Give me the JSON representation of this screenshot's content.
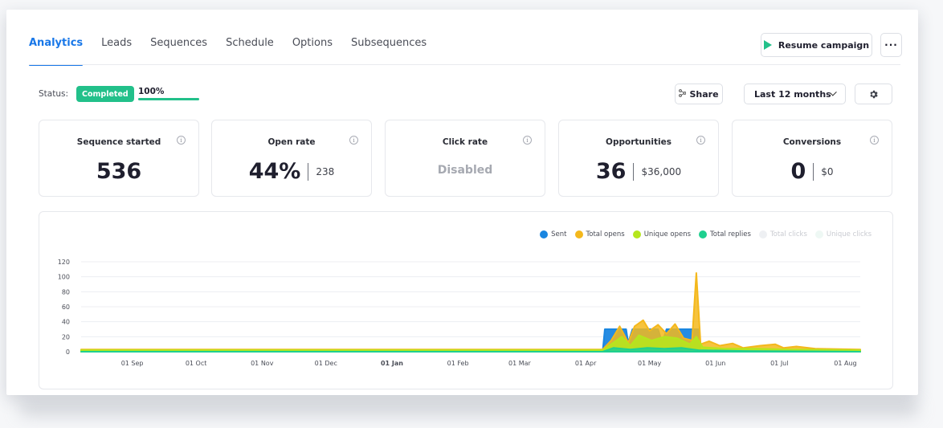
{
  "tabs": [
    {
      "label": "Analytics",
      "active": true
    },
    {
      "label": "Leads",
      "active": false
    },
    {
      "label": "Sequences",
      "active": false
    },
    {
      "label": "Schedule",
      "active": false
    },
    {
      "label": "Options",
      "active": false
    },
    {
      "label": "Subsequences",
      "active": false
    }
  ],
  "header": {
    "resume_label": "Resume campaign",
    "more_label": "···",
    "accent_color": "#1877e8",
    "success_color": "#22c08a"
  },
  "status": {
    "label": "Status:",
    "badge": "Completed",
    "progress_text": "100%",
    "progress_fraction": 1.0
  },
  "toolbar": {
    "share_label": "Share",
    "range_label": "Last 12 months",
    "share_icon": "share-icon",
    "settings_icon": "gear-icon"
  },
  "stats": [
    {
      "title": "Sequence started",
      "value": "536",
      "sub": ""
    },
    {
      "title": "Open rate",
      "value": "44%",
      "sub": "238"
    },
    {
      "title": "Click rate",
      "value": "Disabled",
      "sub": "",
      "disabled": true
    },
    {
      "title": "Opportunities",
      "value": "36",
      "sub": "$36,000"
    },
    {
      "title": "Conversions",
      "value": "0",
      "sub": "$0"
    }
  ],
  "legend": [
    {
      "name": "Sent",
      "color": "#1a86e0",
      "muted": false
    },
    {
      "name": "Total opens",
      "color": "#f4b81c",
      "muted": false
    },
    {
      "name": "Unique opens",
      "color": "#b5e61d",
      "muted": false
    },
    {
      "name": "Total replies",
      "color": "#1fd08f",
      "muted": false
    },
    {
      "name": "Total clicks",
      "color": "#eef0f3",
      "muted": true
    },
    {
      "name": "Unique clicks",
      "color": "#eef8f4",
      "muted": true
    }
  ],
  "chart_data": {
    "type": "area",
    "x_ticks": [
      "01 Sep",
      "01 Oct",
      "01 Nov",
      "01 Dec",
      "01 Jan",
      "01 Feb",
      "01 Mar",
      "01 Apr",
      "01 May",
      "01 Jun",
      "01 Jul",
      "01 Aug"
    ],
    "bold_tick": "01 Jan",
    "y_ticks": [
      "0",
      "20",
      "40",
      "60",
      "80",
      "100",
      "120"
    ],
    "ylim": [
      0,
      120
    ],
    "grid": true,
    "legend_position": "top-right",
    "series": [
      {
        "name": "Sent",
        "color": "#1a86e0",
        "points": [
          [
            "2023-08-08",
            0
          ],
          [
            "2024-04-09",
            0
          ],
          [
            "2024-04-10",
            30
          ],
          [
            "2024-04-20",
            30
          ],
          [
            "2024-04-21",
            12
          ],
          [
            "2024-04-23",
            30
          ],
          [
            "2024-05-05",
            30
          ],
          [
            "2024-05-07",
            12
          ],
          [
            "2024-05-09",
            30
          ],
          [
            "2024-05-24",
            30
          ],
          [
            "2024-05-25",
            0
          ],
          [
            "2024-08-08",
            0
          ]
        ]
      },
      {
        "name": "Total opens",
        "color": "#f4b81c",
        "points": [
          [
            "2023-08-08",
            3
          ],
          [
            "2024-04-09",
            3
          ],
          [
            "2024-04-13",
            15
          ],
          [
            "2024-04-17",
            34
          ],
          [
            "2024-04-21",
            12
          ],
          [
            "2024-04-24",
            34
          ],
          [
            "2024-04-28",
            42
          ],
          [
            "2024-05-01",
            28
          ],
          [
            "2024-05-05",
            36
          ],
          [
            "2024-05-09",
            24
          ],
          [
            "2024-05-13",
            37
          ],
          [
            "2024-05-17",
            18
          ],
          [
            "2024-05-21",
            15
          ],
          [
            "2024-05-23",
            105
          ],
          [
            "2024-05-25",
            10
          ],
          [
            "2024-05-29",
            14
          ],
          [
            "2024-06-03",
            8
          ],
          [
            "2024-06-09",
            11
          ],
          [
            "2024-06-14",
            5
          ],
          [
            "2024-06-22",
            8
          ],
          [
            "2024-06-29",
            10
          ],
          [
            "2024-07-03",
            5
          ],
          [
            "2024-07-09",
            7
          ],
          [
            "2024-07-18",
            4
          ],
          [
            "2024-08-08",
            3
          ]
        ]
      },
      {
        "name": "Unique opens",
        "color": "#b5e61d",
        "points": [
          [
            "2023-08-08",
            2
          ],
          [
            "2024-04-09",
            2
          ],
          [
            "2024-04-14",
            12
          ],
          [
            "2024-04-18",
            20
          ],
          [
            "2024-04-22",
            8
          ],
          [
            "2024-04-26",
            22
          ],
          [
            "2024-05-02",
            15
          ],
          [
            "2024-05-08",
            20
          ],
          [
            "2024-05-14",
            18
          ],
          [
            "2024-05-20",
            10
          ],
          [
            "2024-05-23",
            20
          ],
          [
            "2024-05-26",
            6
          ],
          [
            "2024-06-05",
            4
          ],
          [
            "2024-06-20",
            4
          ],
          [
            "2024-07-05",
            3
          ],
          [
            "2024-08-08",
            2
          ]
        ]
      },
      {
        "name": "Total replies",
        "color": "#1fd08f",
        "points": [
          [
            "2023-08-08",
            0
          ],
          [
            "2024-04-09",
            0
          ],
          [
            "2024-04-14",
            5
          ],
          [
            "2024-04-22",
            3
          ],
          [
            "2024-04-30",
            5
          ],
          [
            "2024-05-08",
            4
          ],
          [
            "2024-05-16",
            5
          ],
          [
            "2024-05-24",
            2
          ],
          [
            "2024-06-15",
            1
          ],
          [
            "2024-08-08",
            0
          ]
        ]
      }
    ]
  }
}
